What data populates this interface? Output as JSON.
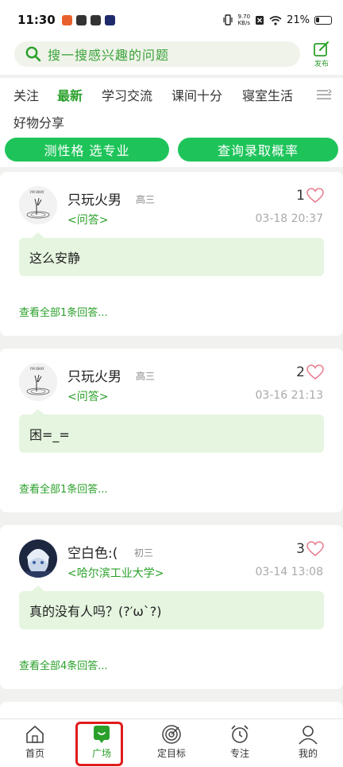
{
  "status_bar": {
    "time": "11:30",
    "net_speed_value": "9.70",
    "net_speed_unit": "KB/s",
    "battery": "21%"
  },
  "search": {
    "placeholder": "搜一搜感兴趣的问题",
    "publish_label": "发布"
  },
  "tabs": [
    {
      "label": "关注",
      "active": false
    },
    {
      "label": "最新",
      "active": true
    },
    {
      "label": "学习交流",
      "active": false
    },
    {
      "label": "课间十分",
      "active": false
    },
    {
      "label": "寝室生活",
      "active": false
    },
    {
      "label": "好物分享",
      "active": false
    }
  ],
  "actions": {
    "left": "测性格  选专业",
    "right": "查询录取概率"
  },
  "posts": [
    {
      "author": "只玩火男",
      "grade": "高三",
      "tag": "<问答>",
      "likes": "1",
      "time": "03-18 20:37",
      "content": "这么安静",
      "view_all": "查看全部1条回答...",
      "avatar": "sketch",
      "avatar_caption": "I'M OKAY"
    },
    {
      "author": "只玩火男",
      "grade": "高三",
      "tag": "<问答>",
      "likes": "2",
      "time": "03-16 21:13",
      "content": "困=_=",
      "view_all": "查看全部1条回答...",
      "avatar": "sketch",
      "avatar_caption": "I'M OKAY"
    },
    {
      "author": "空白色:(",
      "grade": "初三",
      "tag": "<哈尔滨工业大学>",
      "likes": "3",
      "time": "03-14 13:08",
      "content": "真的没有人吗？(?′ω`?)",
      "view_all": "查看全部4条回答...",
      "avatar": "anime"
    }
  ],
  "bottom_nav": [
    {
      "label": "首页",
      "icon": "home-icon"
    },
    {
      "label": "广场",
      "icon": "square-chat-icon",
      "active": true
    },
    {
      "label": "定目标",
      "icon": "target-icon"
    },
    {
      "label": "专注",
      "icon": "alarm-clock-icon"
    },
    {
      "label": "我的",
      "icon": "person-icon"
    }
  ],
  "colors": {
    "accent": "#2aa02a",
    "pill": "#1ec45a",
    "bubble": "#e5f5e0",
    "highlight": "#e01b1b"
  }
}
